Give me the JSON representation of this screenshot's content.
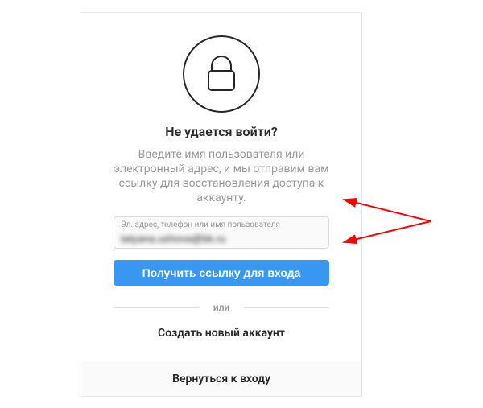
{
  "title": "Не удается войти?",
  "description": "Введите имя пользователя или электронный адрес, и мы отправим вам ссылку для восстановления доступа к аккаунту.",
  "field": {
    "label": "Эл. адрес, телефон или имя пользователя",
    "value": "tatyana.ushova@bk.ru"
  },
  "submit_label": "Получить ссылку для входа",
  "divider": "или",
  "create_account": "Создать новый аккаунт",
  "back": "Вернуться к входу"
}
